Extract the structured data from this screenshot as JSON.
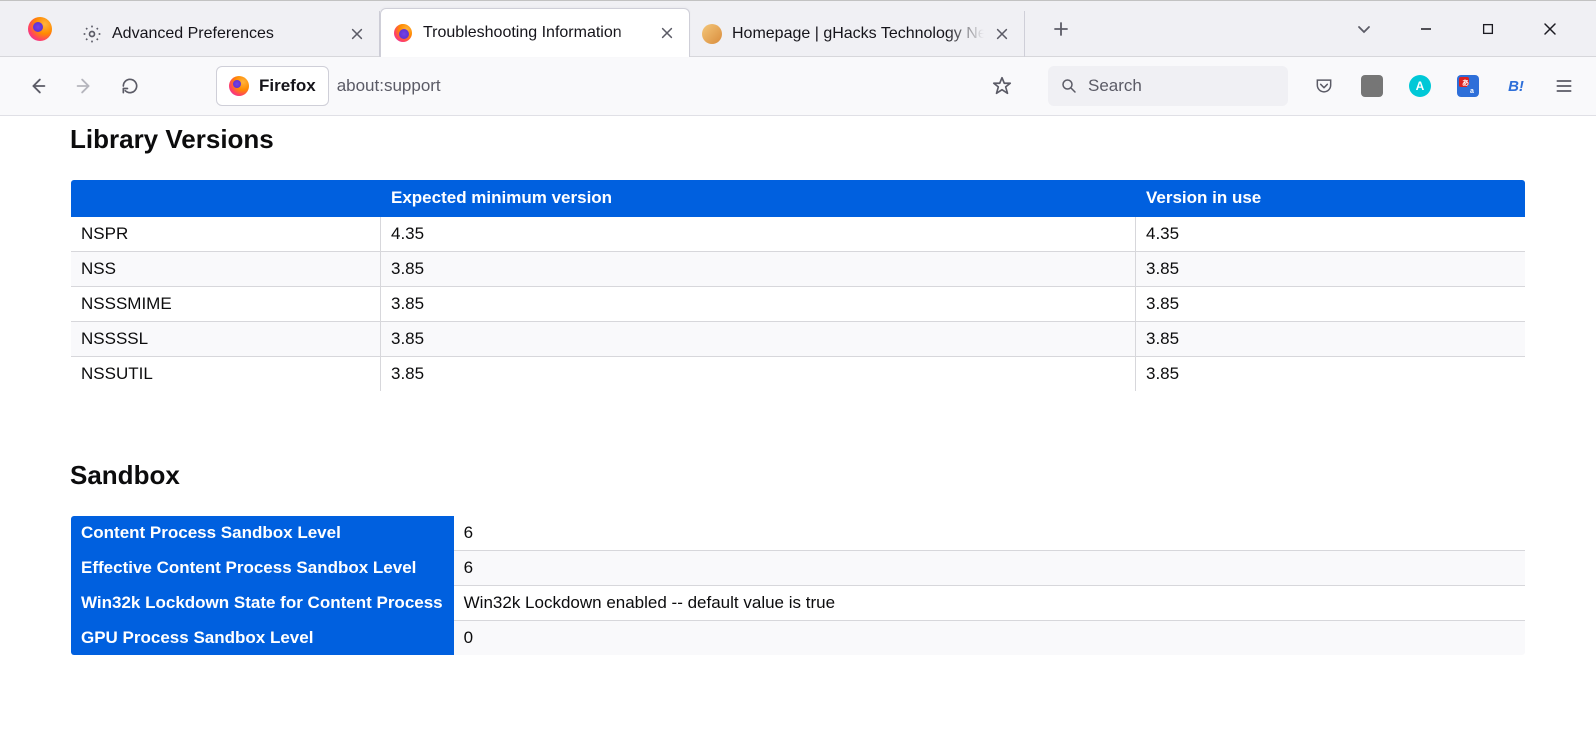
{
  "tabs": [
    {
      "title": "Advanced Preferences",
      "favicon": "gear-icon"
    },
    {
      "title": "Troubleshooting Information",
      "favicon": "firefox-icon",
      "active": true
    },
    {
      "title": "Homepage | gHacks Technology News",
      "favicon": "ghacks-icon"
    }
  ],
  "toolbar": {
    "url_label": "Firefox",
    "url_path": "about:support",
    "search_placeholder": "Search"
  },
  "sections": {
    "library": {
      "heading": "Library Versions",
      "columns": [
        "",
        "Expected minimum version",
        "Version in use"
      ],
      "rows": [
        {
          "name": "NSPR",
          "expected": "4.35",
          "inuse": "4.35"
        },
        {
          "name": "NSS",
          "expected": "3.85",
          "inuse": "3.85"
        },
        {
          "name": "NSSSMIME",
          "expected": "3.85",
          "inuse": "3.85"
        },
        {
          "name": "NSSSSL",
          "expected": "3.85",
          "inuse": "3.85"
        },
        {
          "name": "NSSUTIL",
          "expected": "3.85",
          "inuse": "3.85"
        }
      ]
    },
    "sandbox": {
      "heading": "Sandbox",
      "rows": [
        {
          "label": "Content Process Sandbox Level",
          "value": "6"
        },
        {
          "label": "Effective Content Process Sandbox Level",
          "value": "6"
        },
        {
          "label": "Win32k Lockdown State for Content Process",
          "value": "Win32k Lockdown enabled -- default value is true"
        },
        {
          "label": "GPU Process Sandbox Level",
          "value": "0"
        }
      ]
    }
  }
}
